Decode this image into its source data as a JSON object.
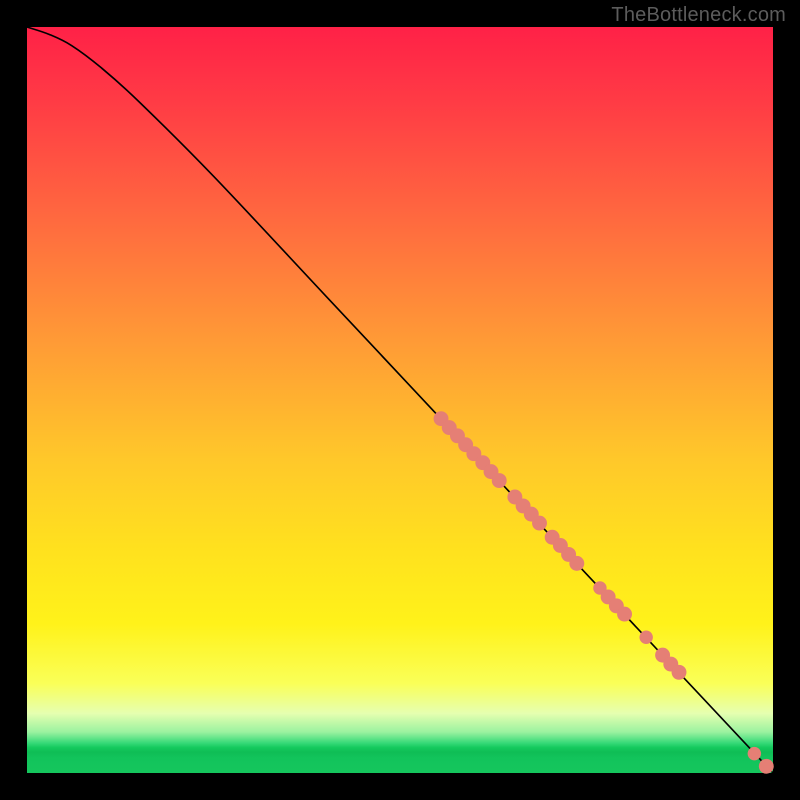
{
  "attribution": "TheBottleneck.com",
  "colors": {
    "dot": "#e57f75",
    "line": "#000000"
  },
  "chart_data": {
    "type": "line",
    "title": "",
    "xlabel": "",
    "ylabel": "",
    "xlim": [
      0,
      100
    ],
    "ylim": [
      0,
      100
    ],
    "grid": false,
    "series": [
      {
        "name": "curve",
        "points": [
          {
            "x": 0,
            "y": 100
          },
          {
            "x": 3,
            "y": 99
          },
          {
            "x": 6,
            "y": 97.5
          },
          {
            "x": 10,
            "y": 94.5
          },
          {
            "x": 15,
            "y": 90
          },
          {
            "x": 25,
            "y": 80
          },
          {
            "x": 40,
            "y": 64
          },
          {
            "x": 55,
            "y": 48
          },
          {
            "x": 70,
            "y": 32
          },
          {
            "x": 85,
            "y": 16
          },
          {
            "x": 100,
            "y": 0
          }
        ]
      }
    ],
    "scatter": [
      {
        "x": 55.5,
        "y": 47.5,
        "r": 1.0
      },
      {
        "x": 56.6,
        "y": 46.3,
        "r": 1.0
      },
      {
        "x": 57.7,
        "y": 45.2,
        "r": 1.0
      },
      {
        "x": 58.8,
        "y": 44.0,
        "r": 1.0
      },
      {
        "x": 59.9,
        "y": 42.8,
        "r": 1.0
      },
      {
        "x": 61.1,
        "y": 41.6,
        "r": 1.0
      },
      {
        "x": 62.2,
        "y": 40.4,
        "r": 1.0
      },
      {
        "x": 63.3,
        "y": 39.2,
        "r": 1.0
      },
      {
        "x": 65.4,
        "y": 37.0,
        "r": 1.0
      },
      {
        "x": 66.5,
        "y": 35.8,
        "r": 1.0
      },
      {
        "x": 67.6,
        "y": 34.7,
        "r": 1.0
      },
      {
        "x": 68.7,
        "y": 33.5,
        "r": 1.0
      },
      {
        "x": 70.4,
        "y": 31.6,
        "r": 1.0
      },
      {
        "x": 71.5,
        "y": 30.5,
        "r": 1.0
      },
      {
        "x": 72.6,
        "y": 29.3,
        "r": 1.0
      },
      {
        "x": 73.7,
        "y": 28.1,
        "r": 1.0
      },
      {
        "x": 76.8,
        "y": 24.8,
        "r": 0.9
      },
      {
        "x": 77.9,
        "y": 23.6,
        "r": 1.0
      },
      {
        "x": 79.0,
        "y": 22.4,
        "r": 1.0
      },
      {
        "x": 80.1,
        "y": 21.3,
        "r": 1.0
      },
      {
        "x": 83.0,
        "y": 18.2,
        "r": 0.9
      },
      {
        "x": 85.2,
        "y": 15.8,
        "r": 1.0
      },
      {
        "x": 86.3,
        "y": 14.6,
        "r": 1.0
      },
      {
        "x": 87.4,
        "y": 13.5,
        "r": 1.0
      },
      {
        "x": 97.5,
        "y": 2.6,
        "r": 0.9
      },
      {
        "x": 99.1,
        "y": 0.9,
        "r": 1.0
      }
    ]
  }
}
